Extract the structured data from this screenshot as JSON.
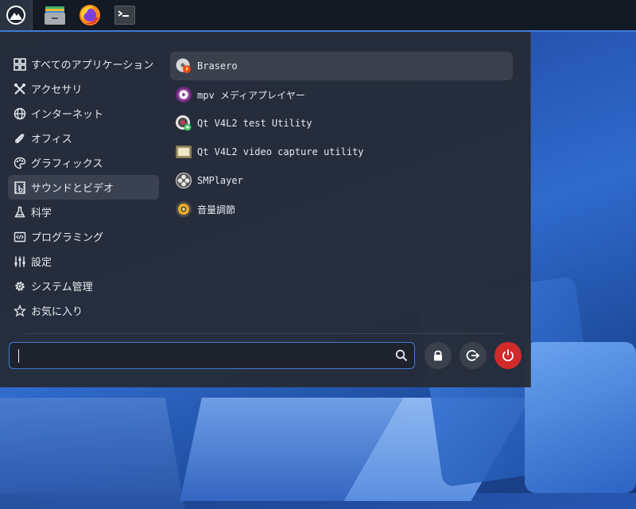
{
  "taskbar": {
    "items": [
      {
        "name": "start-menu",
        "icon": "mountain-logo-icon"
      },
      {
        "name": "files",
        "icon": "folder-icon"
      },
      {
        "name": "firefox",
        "icon": "firefox-icon"
      },
      {
        "name": "terminal",
        "icon": "terminal-icon"
      }
    ]
  },
  "categories": [
    {
      "label": "すべてのアプリケーション",
      "icon": "grid-icon"
    },
    {
      "label": "アクセサリ",
      "icon": "tools-icon"
    },
    {
      "label": "インターネット",
      "icon": "globe-icon"
    },
    {
      "label": "オフィス",
      "icon": "paperclip-icon"
    },
    {
      "label": "グラフィックス",
      "icon": "palette-icon"
    },
    {
      "label": "サウンドとビデオ",
      "icon": "film-icon",
      "active": true
    },
    {
      "label": "科学",
      "icon": "flask-icon"
    },
    {
      "label": "プログラミング",
      "icon": "code-icon"
    },
    {
      "label": "設定",
      "icon": "sliders-icon"
    },
    {
      "label": "システム管理",
      "icon": "gear-icon"
    },
    {
      "label": "お気に入り",
      "icon": "star-icon"
    }
  ],
  "apps": [
    {
      "label": "Brasero",
      "icon": "brasero-icon",
      "active": true
    },
    {
      "label": "mpv メディアプレイヤー",
      "icon": "mpv-icon"
    },
    {
      "label": "Qt V4L2 test Utility",
      "icon": "webcam-icon"
    },
    {
      "label": "Qt V4L2 video capture utility",
      "icon": "monitor-icon"
    },
    {
      "label": "SMPlayer",
      "icon": "smplayer-icon"
    },
    {
      "label": "音量調節",
      "icon": "volume-icon"
    }
  ],
  "search": {
    "value": "",
    "placeholder": ""
  },
  "actions": [
    {
      "name": "lock",
      "icon": "lock-icon"
    },
    {
      "name": "logout",
      "icon": "logout-icon"
    },
    {
      "name": "power",
      "icon": "power-icon"
    }
  ],
  "colors": {
    "accent": "#3f7ad8",
    "power": "#d02a2a",
    "panel": "#252a35"
  }
}
